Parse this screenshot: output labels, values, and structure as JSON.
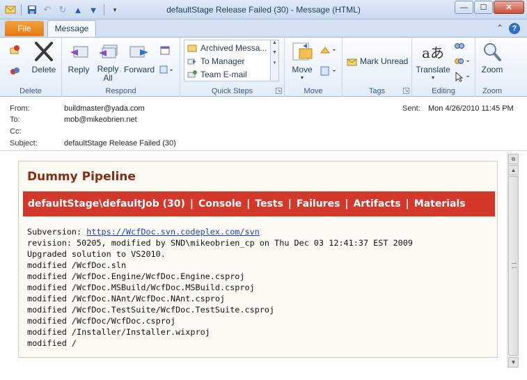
{
  "window": {
    "title": "defaultStage Release Failed (30)  -  Message (HTML)",
    "controls": {
      "minimize": "—",
      "maximize": "☐",
      "close": "✕"
    }
  },
  "tabs": {
    "file": "File",
    "message": "Message",
    "help": "?",
    "collapse": "⌃"
  },
  "ribbon": {
    "delete": {
      "label": "Delete",
      "group": "Delete"
    },
    "respond": {
      "reply": "Reply",
      "reply_all": "Reply All",
      "forward": "Forward",
      "group": "Respond"
    },
    "quick_steps": {
      "items": [
        "Archived Messa...",
        "To Manager",
        "Team E-mail"
      ],
      "group": "Quick Steps"
    },
    "move": {
      "label": "Move",
      "group": "Move"
    },
    "tags": {
      "mark_unread": "Mark Unread",
      "group": "Tags"
    },
    "editing": {
      "translate": "Translate",
      "group": "Editing"
    },
    "zoom": {
      "label": "Zoom",
      "group": "Zoom"
    }
  },
  "header": {
    "from_label": "From:",
    "from": "buildmaster@yada.com",
    "to_label": "To:",
    "to": "mob@mikeobrien.net",
    "cc_label": "Cc:",
    "subject_label": "Subject:",
    "subject": "defaultStage Release Failed (30)",
    "sent_label": "Sent:",
    "sent": "Mon 4/26/2010 11:45 PM"
  },
  "message": {
    "pipeline": "Dummy Pipeline",
    "nav": {
      "job": "defaultStage\\defaultJob (30)",
      "console": "Console",
      "tests": "Tests",
      "failures": "Failures",
      "artifacts": "Artifacts",
      "materials": "Materials",
      "separator": "|"
    },
    "subversion_label": "Subversion: ",
    "subversion_url": "https://WcfDoc.svn.codeplex.com/svn",
    "revision": "revision: 50205, modified by SND\\mikeobrien_cp on Thu Dec 03 12:41:37 EST 2009",
    "comment": "Upgraded solution to VS2010.",
    "files": [
      "modified /WcfDoc.sln",
      "modified /WcfDoc.Engine/WcfDoc.Engine.csproj",
      "modified /WcfDoc.MSBuild/WcfDoc.MSBuild.csproj",
      "modified /WcfDoc.NAnt/WcfDoc.NAnt.csproj",
      "modified /WcfDoc.TestSuite/WcfDoc.TestSuite.csproj",
      "modified /WcfDoc/WcfDoc.csproj",
      "modified /Installer/Installer.wixproj",
      "modified /"
    ]
  }
}
